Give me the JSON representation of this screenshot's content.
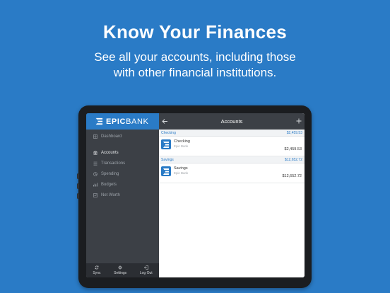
{
  "promo": {
    "headline": "Know Your Finances",
    "sub_line1": "See all your accounts, including those",
    "sub_line2": "with other financial institutions."
  },
  "brand": {
    "name_bold": "EPIC",
    "name_light": "BANK",
    "color": "#2a7bc6"
  },
  "sidebar": {
    "items": [
      {
        "label": "Dashboard",
        "icon": "dashboard-icon",
        "active": false
      },
      {
        "label": "Accounts",
        "icon": "accounts-icon",
        "active": true
      },
      {
        "label": "Transactions",
        "icon": "transactions-icon",
        "active": false
      },
      {
        "label": "Spending",
        "icon": "spending-icon",
        "active": false
      },
      {
        "label": "Budgets",
        "icon": "budgets-icon",
        "active": false
      },
      {
        "label": "Net Worth",
        "icon": "net-worth-icon",
        "active": false
      }
    ],
    "footer": [
      {
        "label": "Sync",
        "icon": "sync-icon"
      },
      {
        "label": "Settings",
        "icon": "gear-icon"
      },
      {
        "label": "Log Out",
        "icon": "logout-icon"
      }
    ]
  },
  "main": {
    "title": "Accounts",
    "sections": [
      {
        "name": "Checking",
        "total": "$2,459.53",
        "account": {
          "name": "Checking",
          "institution": "Epic Bank",
          "balance": "$2,459.53"
        }
      },
      {
        "name": "Savings",
        "total": "$12,652.72",
        "account": {
          "name": "Savings",
          "institution": "Epic Bank",
          "balance": "$12,652.72"
        }
      }
    ]
  }
}
